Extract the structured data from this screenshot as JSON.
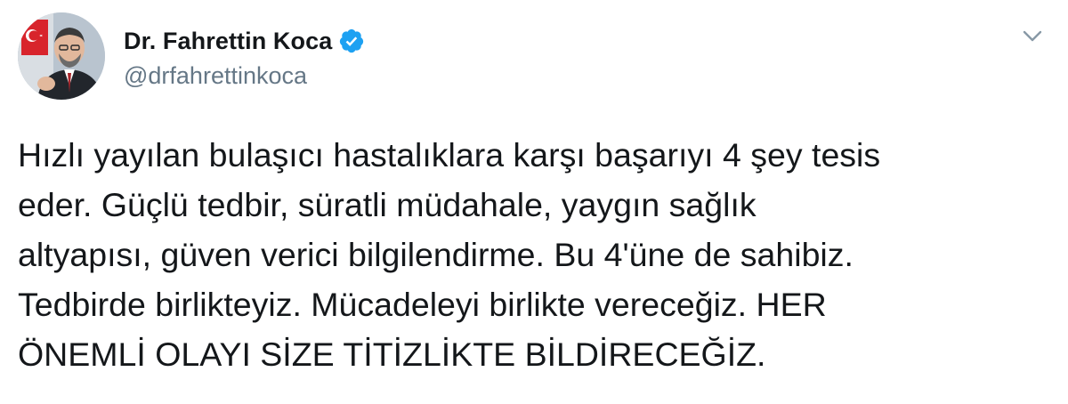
{
  "author": {
    "display_name": "Dr. Fahrettin Koca",
    "handle": "@drfahrettinkoca",
    "verified": true
  },
  "tweet": {
    "text": "Hızlı yayılan bulaşıcı hastalıklara karşı başarıyı 4 şey tesis\neder. Güçlü tedbir, süratli müdahale, yaygın sağlık\naltyapısı, güven verici bilgilendirme. Bu 4'üne de sahibiz.\nTedbirde birlikteyiz. Mücadeleyi birlikte vereceğiz. HER\nÖNEMLİ OLAYI SİZE TİTİZLİKTE BİLDİRECEĞİZ."
  },
  "icons": {
    "verified": "verified-badge-icon",
    "menu": "chevron-down-icon",
    "avatar": "profile-photo"
  },
  "colors": {
    "text": "#14171a",
    "secondary_text": "#657786",
    "verified_blue": "#1da1f2",
    "background": "#ffffff"
  }
}
